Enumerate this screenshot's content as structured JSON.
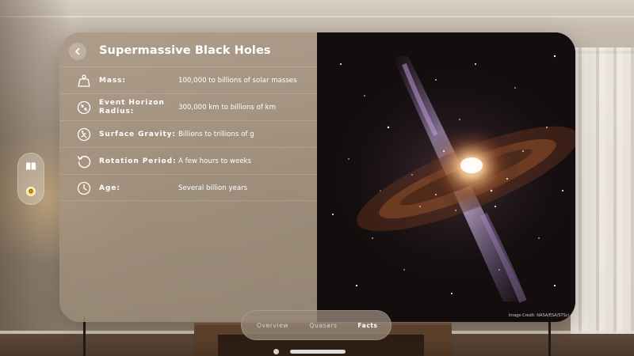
{
  "window": {
    "title": "Supermassive Black Holes",
    "back_icon": "chevron-left-icon"
  },
  "facts": [
    {
      "icon": "weight-icon",
      "label": "Mass:",
      "value": "100,000 to billions of solar masses"
    },
    {
      "icon": "event-horizon-icon",
      "label": "Event Horizon Radius:",
      "value": "300,000 km to billions of km"
    },
    {
      "icon": "gravity-icon",
      "label": "Surface Gravity:",
      "value": "Billions to trillions of g"
    },
    {
      "icon": "rotation-icon",
      "label": "Rotation Period:",
      "value": "A few hours to weeks"
    },
    {
      "icon": "clock-icon",
      "label": "Age:",
      "value": "Several billion years"
    }
  ],
  "image": {
    "credit": "Image Credit: NASA/ESA/STScI"
  },
  "tabs": [
    {
      "label": "Overview",
      "active": false
    },
    {
      "label": "Quasars",
      "active": false
    },
    {
      "label": "Facts",
      "active": true
    }
  ],
  "side_ornament": {
    "items": [
      "book-icon",
      "coin-icon"
    ],
    "coin_glyph": "0"
  },
  "colors": {
    "pane_glass": "#9c8a78",
    "text": "#ffffff",
    "space_background": "#120c0c"
  }
}
